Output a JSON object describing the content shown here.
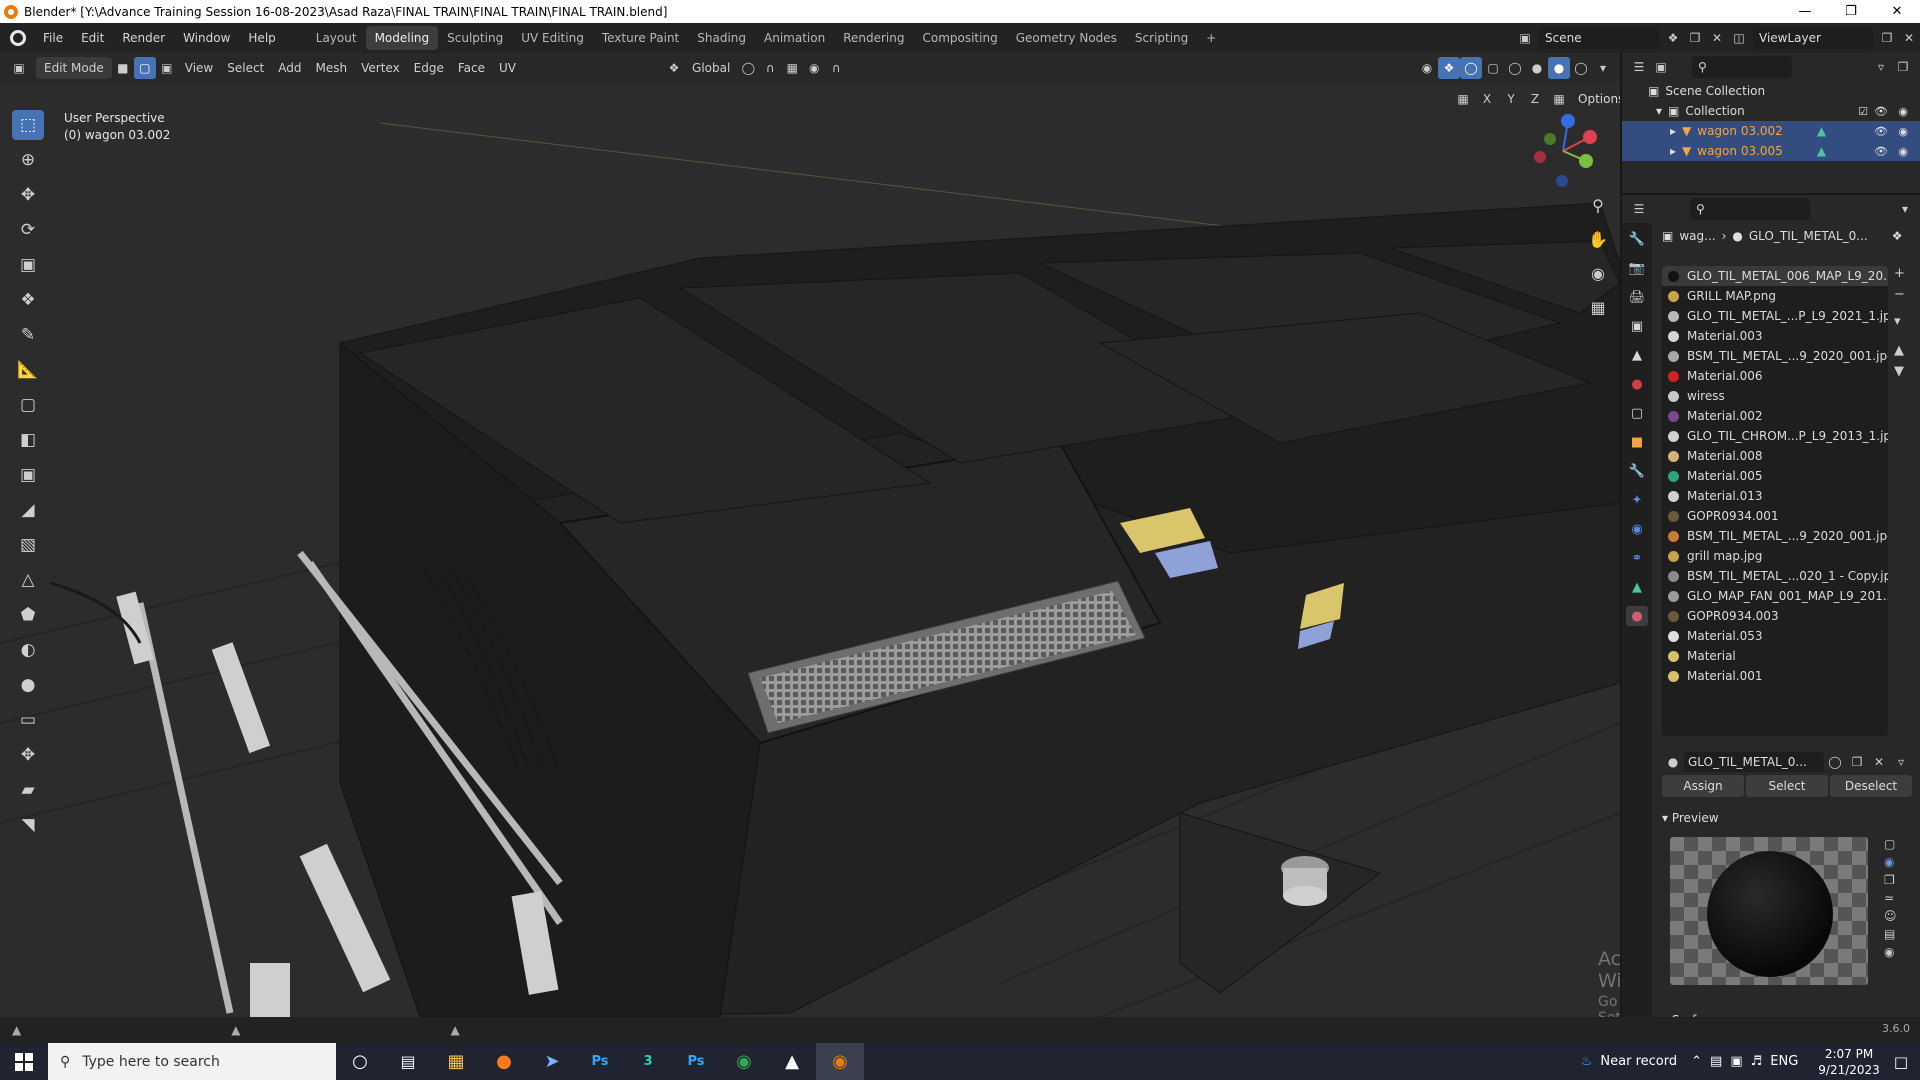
{
  "window": {
    "title": "Blender* [Y:\\Advance Training Session 16-08-2023\\Asad Raza\\FINAL TRAIN\\FINAL TRAIN\\FINAL TRAIN.blend]"
  },
  "menu": [
    "File",
    "Edit",
    "Render",
    "Window",
    "Help"
  ],
  "workspaces": [
    "Layout",
    "Modeling",
    "Sculpting",
    "UV Editing",
    "Texture Paint",
    "Shading",
    "Animation",
    "Rendering",
    "Compositing",
    "Geometry Nodes",
    "Scripting"
  ],
  "active_workspace": "Modeling",
  "topbar": {
    "scene": "Scene",
    "view_layer": "ViewLayer"
  },
  "viewport_header": {
    "mode": "Edit Mode",
    "menus": [
      "View",
      "Select",
      "Add",
      "Mesh",
      "Vertex",
      "Edge",
      "Face",
      "UV"
    ],
    "transform_orientation": "Global",
    "axes": [
      "X",
      "Y",
      "Z"
    ],
    "options": "Options"
  },
  "viewport": {
    "perspective_label": "User Perspective",
    "object_label": "(0) wagon 03.002"
  },
  "outliner": {
    "scene_collection": "Scene Collection",
    "collection": "Collection",
    "objects": [
      {
        "name": "wagon 03.002",
        "selected": true
      },
      {
        "name": "wagon 03.005",
        "selected": true
      }
    ]
  },
  "properties": {
    "breadcrumb_object": "wag...",
    "breadcrumb_material": "GLO_TIL_METAL_0...",
    "material_slots": [
      {
        "name": "GLO_TIL_METAL_006_MAP_L9_20...",
        "color": "#111111",
        "active": true
      },
      {
        "name": "GRILL MAP.png",
        "color": "#c9a24a"
      },
      {
        "name": "GLO_TIL_METAL_...P_L9_2021_1.jpg",
        "color": "#b8b8b8"
      },
      {
        "name": "Material.003",
        "color": "#d4d4d4"
      },
      {
        "name": "BSM_TIL_METAL_...9_2020_001.jpg",
        "color": "#a8a8a8"
      },
      {
        "name": "Material.006",
        "color": "#d42020"
      },
      {
        "name": "wiress",
        "color": "#c8c8c8"
      },
      {
        "name": "Material.002",
        "color": "#7a4a8c"
      },
      {
        "name": "GLO_TIL_CHROM...P_L9_2013_1.jpg",
        "color": "#d0d0d0"
      },
      {
        "name": "Material.008",
        "color": "#d8b070"
      },
      {
        "name": "Material.005",
        "color": "#2aa878"
      },
      {
        "name": "Material.013",
        "color": "#cfcfcf"
      },
      {
        "name": "GOPR0934.001",
        "color": "#6a5a3c"
      },
      {
        "name": "BSM_TIL_METAL_...9_2020_001.jpg",
        "color": "#c87a3a"
      },
      {
        "name": "grill map.jpg",
        "color": "#c9a24a"
      },
      {
        "name": "BSM_TIL_METAL_...020_1 - Copy.jpg",
        "color": "#8a8a8a"
      },
      {
        "name": "GLO_MAP_FAN_001_MAP_L9_201...",
        "color": "#9a9a9a"
      },
      {
        "name": "GOPR0934.003",
        "color": "#6a5a3c"
      },
      {
        "name": "Material.053",
        "color": "#e0e0e0"
      },
      {
        "name": "Material",
        "color": "#d8c068"
      },
      {
        "name": "Material.001",
        "color": "#d8c068"
      }
    ],
    "material_field": "GLO_TIL_METAL_0...",
    "buttons": {
      "assign": "Assign",
      "select": "Select",
      "deselect": "Deselect"
    },
    "preview_label": "Preview",
    "surface_label": "Surface"
  },
  "watermark": {
    "line1": "Activate Windows",
    "line2": "Go to Settings to activate Windows."
  },
  "status": {
    "version": "3.6.0"
  },
  "taskbar": {
    "search_placeholder": "Type here to search",
    "weather": "Near record",
    "lang": "ENG",
    "time": "2:07 PM",
    "date": "9/21/2023"
  }
}
